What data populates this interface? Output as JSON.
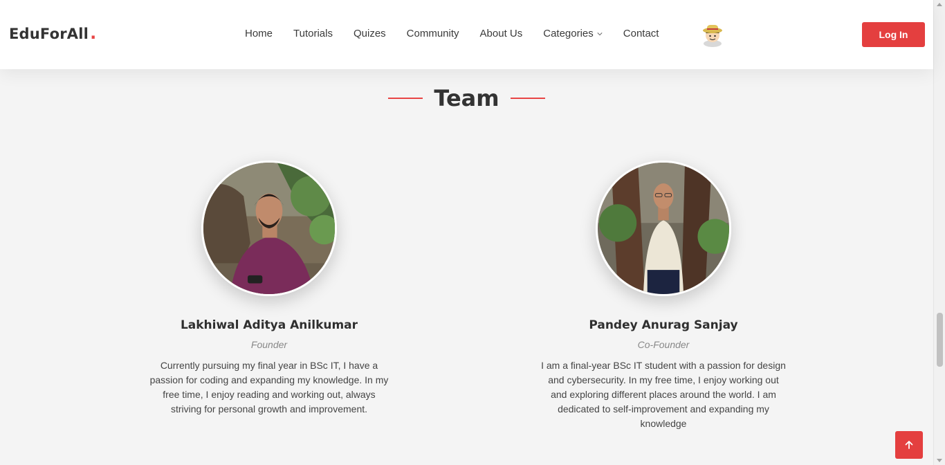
{
  "header": {
    "logo": "EduForAll",
    "logo_dot": ".",
    "nav": [
      "Home",
      "Tutorials",
      "Quizes",
      "Community",
      "About Us",
      "Categories",
      "Contact"
    ],
    "login_label": "Log In"
  },
  "section": {
    "title": "Team"
  },
  "team": [
    {
      "name": "Lakhiwal Aditya Anilkumar",
      "role": "Founder",
      "bio": "Currently pursuing my final year in BSc IT, I have a passion for coding and expanding my knowledge. In my free time, I enjoy reading and working out, always striving for personal growth and improvement."
    },
    {
      "name": "Pandey Anurag Sanjay",
      "role": "Co-Founder",
      "bio": "I am a final-year BSc IT student with a passion for design and cybersecurity. In my free time, I enjoy working out and exploring different places around the world. I am dedicated to self-improvement and expanding my knowledge"
    }
  ],
  "colors": {
    "accent": "#e43f3f",
    "background": "#f4f4f4"
  },
  "icons": {
    "scroll_top": "arrow-up-icon",
    "categories": "chevron-down-icon",
    "profile": "avatar-icon"
  }
}
